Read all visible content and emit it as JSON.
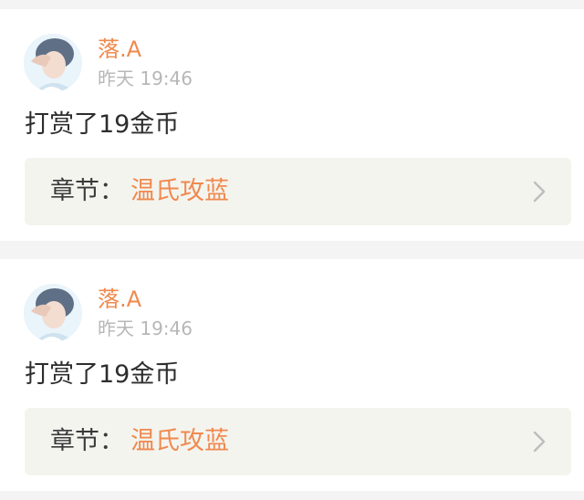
{
  "colors": {
    "accent": "#f0894e",
    "muted_text": "#b7b7b7",
    "body_text": "#2d2d2d",
    "chapter_bg": "#f4f4ef",
    "page_bg": "#f4f4f4"
  },
  "records": [
    {
      "username": "落.A",
      "timestamp": "昨天 19:46",
      "message": "打赏了19金币",
      "chapter_label": "章节：",
      "chapter_title": "温氏攻蓝",
      "chevron_icon": "chevron-right-icon"
    },
    {
      "username": "落.A",
      "timestamp": "昨天 19:46",
      "message": "打赏了19金币",
      "chapter_label": "章节：",
      "chapter_title": "温氏攻蓝",
      "chevron_icon": "chevron-right-icon"
    }
  ]
}
